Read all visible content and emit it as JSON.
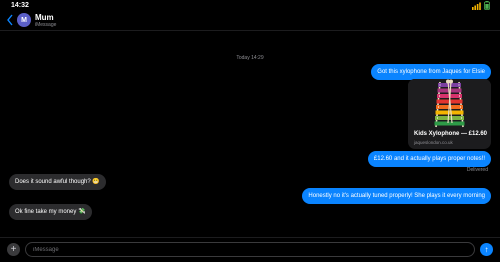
{
  "status": {
    "time": "14:32",
    "icons": [
      "wifi-icon",
      "battery-icon"
    ]
  },
  "header": {
    "contact_name": "Mum",
    "contact_initial": "M",
    "subtitle": "iMessage"
  },
  "thread": {
    "timestamp": "Today 14:29",
    "messages": [
      {
        "direction": "outgoing",
        "text": "Got this xylophone from Jaques for Elsie"
      },
      {
        "direction": "outgoing",
        "type": "link_preview",
        "title": "Kids Xylophone — £12.60",
        "url": "jaqueslondon.co.uk"
      },
      {
        "direction": "outgoing",
        "text": "£12.60 and it actually plays proper notes!!"
      },
      {
        "direction": "incoming",
        "text": "Does it sound awful though? 😬"
      },
      {
        "direction": "outgoing",
        "text": "Honestly no it's actually tuned properly! She plays it every morning"
      },
      {
        "direction": "incoming",
        "text": "Ok fine take my money 💸"
      }
    ],
    "delivered_label": "Delivered"
  },
  "composer": {
    "placeholder": "iMessage",
    "plus_label": "+",
    "send_label": "↑"
  },
  "colors": {
    "outgoing": "#0a84ff",
    "incoming": "#2c2c2e",
    "avatar": "#5b5fc7",
    "background": "#000000"
  }
}
